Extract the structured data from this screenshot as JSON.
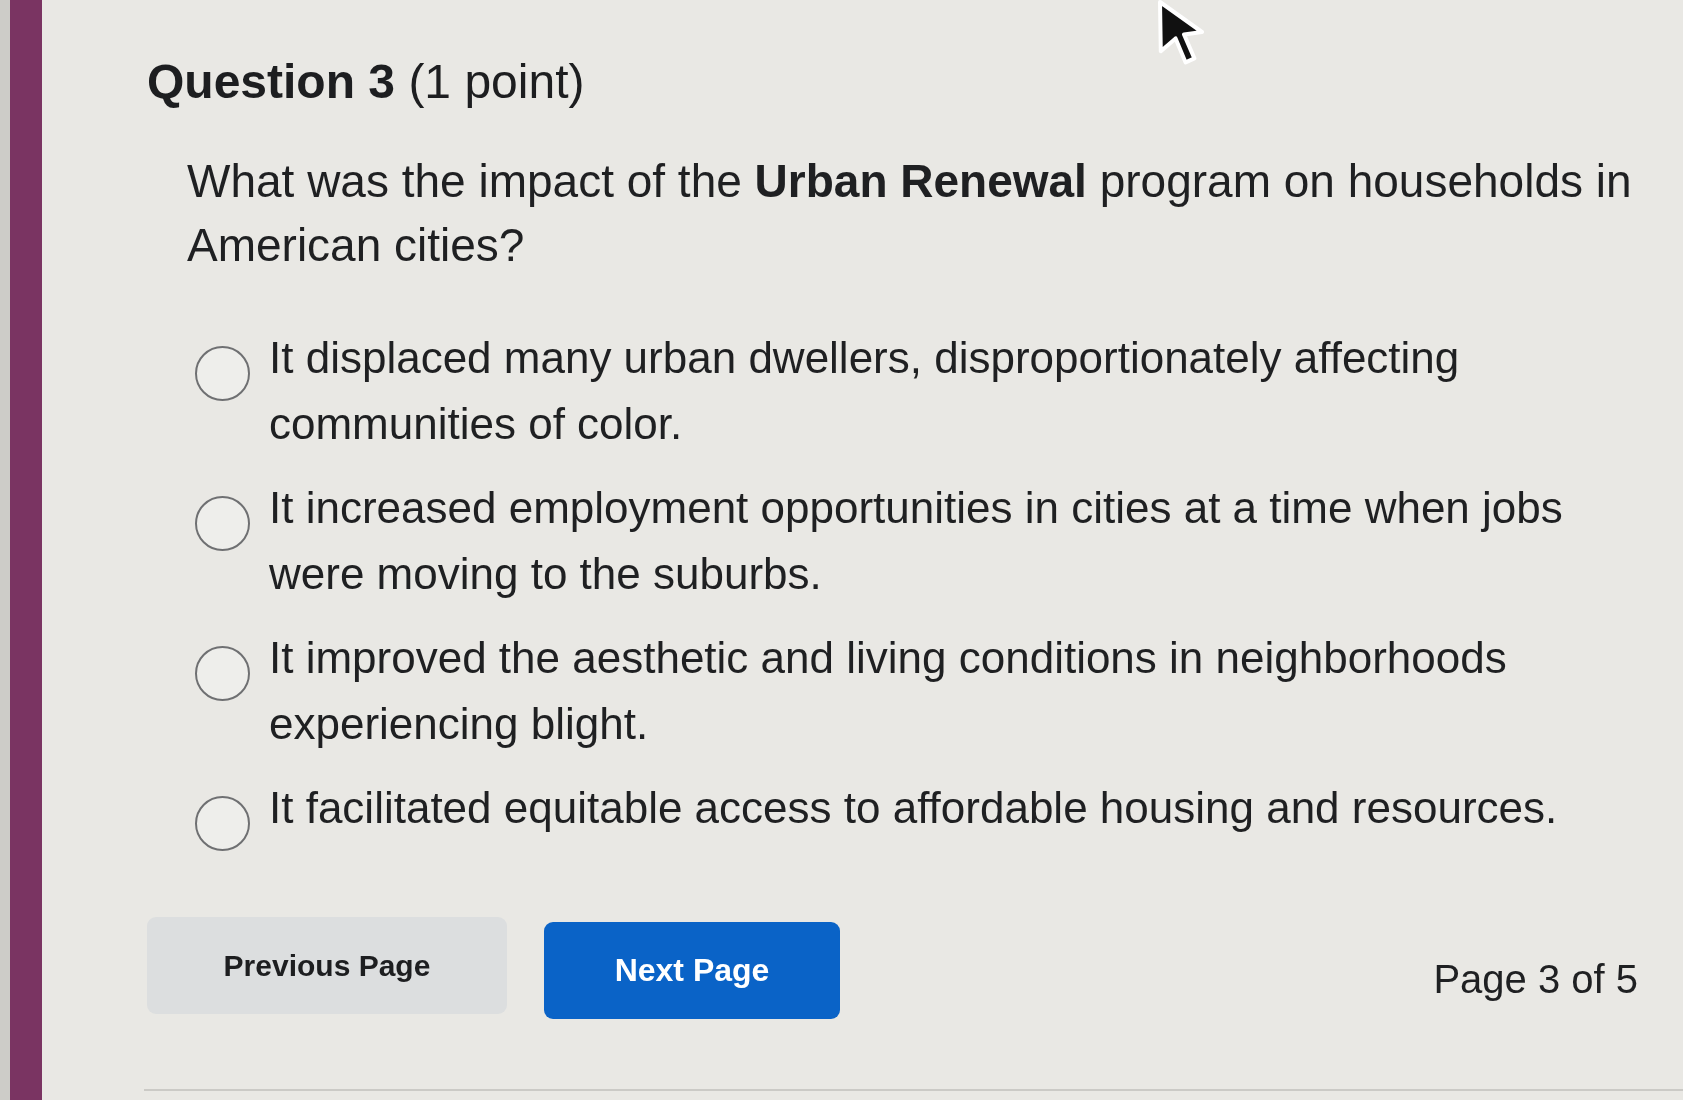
{
  "question": {
    "title": "**Question 3** (1 point)",
    "prompt": "What was the impact of the **Urban Renewal** program on households in American cities?",
    "options": [
      {
        "label": "It displaced many urban dwellers, disproportionately affecting communities of color.",
        "selected": false
      },
      {
        "label": "It increased employment opportunities in cities at a time when jobs were moving to the suburbs.",
        "selected": false
      },
      {
        "label": "It improved the aesthetic and living conditions in neighborhoods experiencing blight.",
        "selected": false
      },
      {
        "label": "It facilitated equitable access to affordable housing and resources.",
        "selected": false
      }
    ]
  },
  "navigation": {
    "previous": "Previous Page",
    "next": "Next Page",
    "page_indicator": "Page 3 of 5"
  }
}
